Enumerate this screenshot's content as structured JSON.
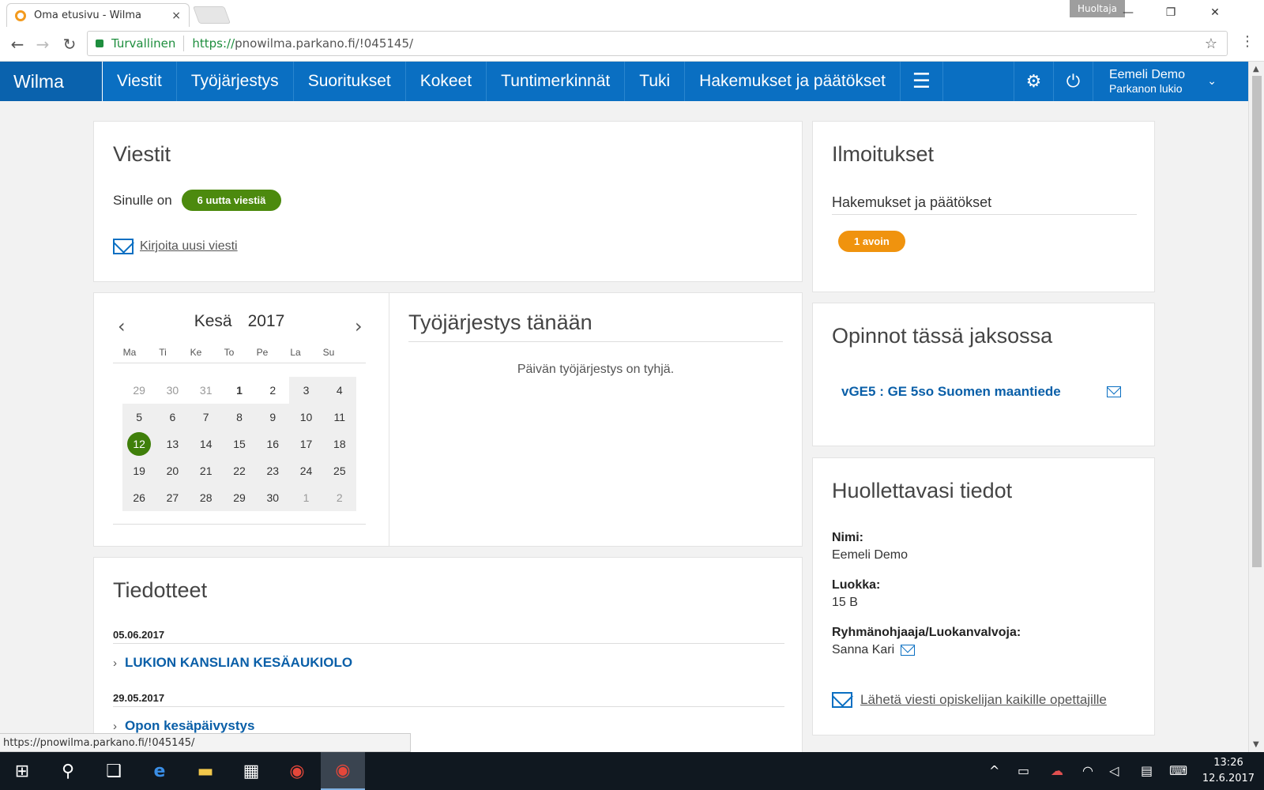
{
  "browser": {
    "tab_title": "Oma etusivu - Wilma",
    "tab_close": "×",
    "profile_chip": "Huoltaja",
    "minimize": "—",
    "restore": "❐",
    "close": "✕",
    "back": "←",
    "forward": "→",
    "reload": "↻",
    "secure_label": "Turvallinen",
    "url_scheme": "https://",
    "url_rest": "pnowilma.parkano.fi/!045145/",
    "star": "☆",
    "menu": "⋮",
    "status_url": "https://pnowilma.parkano.fi/!045145/"
  },
  "nav": {
    "brand": "Wilma",
    "items": [
      "Viestit",
      "Työjärjestys",
      "Suoritukset",
      "Kokeet",
      "Tuntimerkinnät",
      "Tuki",
      "Hakemukset ja päätökset"
    ],
    "hamburger": "☰",
    "settings_icon": "⚙",
    "power_icon": "⏻",
    "user_name": "Eemeli Demo",
    "user_school": "Parkanon lukio",
    "chevron": "⌄"
  },
  "messages": {
    "title": "Viestit",
    "intro": "Sinulle on",
    "badge": "6 uutta viestiä",
    "write_link": "Kirjoita uusi viesti"
  },
  "calendar": {
    "month": "Kesä",
    "year": "2017",
    "prev": "‹",
    "next": "›",
    "weekdays": [
      "Ma",
      "Ti",
      "Ke",
      "To",
      "Pe",
      "La",
      "Su"
    ],
    "weeks": [
      [
        "29",
        "30",
        "31",
        "1",
        "2",
        "3",
        "4"
      ],
      [
        "5",
        "6",
        "7",
        "8",
        "9",
        "10",
        "11"
      ],
      [
        "12",
        "13",
        "14",
        "15",
        "16",
        "17",
        "18"
      ],
      [
        "19",
        "20",
        "21",
        "22",
        "23",
        "24",
        "25"
      ],
      [
        "26",
        "27",
        "28",
        "29",
        "30",
        "1",
        "2"
      ]
    ]
  },
  "schedule": {
    "title": "Työjärjestys tänään",
    "empty": "Päivän työjärjestys on tyhjä."
  },
  "bulletins": {
    "title": "Tiedotteet",
    "items": [
      {
        "date": "05.06.2017",
        "link": "LUKION KANSLIAN KESÄAUKIOLO"
      },
      {
        "date": "29.05.2017",
        "link": "Opon kesäpäivystys"
      }
    ]
  },
  "notices": {
    "title": "Ilmoitukset",
    "section": "Hakemukset ja päätökset",
    "badge": "1 avoin"
  },
  "studies": {
    "title": "Opinnot tässä jaksossa",
    "course": "vGE5 : GE 5so Suomen maantiede"
  },
  "student": {
    "title": "Huollettavasi tiedot",
    "name_label": "Nimi:",
    "name": "Eemeli Demo",
    "class_label": "Luokka:",
    "class": "15 B",
    "teacher_label": "Ryhmänohjaaja/Luokanvalvoja:",
    "teacher": "Sanna Kari",
    "send_all": "Lähetä viesti opiskelijan kaikille opettajille"
  },
  "taskbar": {
    "start": "⊞",
    "search": "⚲",
    "taskview": "❑",
    "edge": "e",
    "explorer": "▬",
    "store": "▦",
    "chrome1": "◉",
    "chrome2": "◉",
    "tray_up": "^",
    "time": "13:26",
    "date": "12.6.2017"
  },
  "colors": {
    "nav_blue": "#0a6fc2",
    "badge_green": "#4c8a0e",
    "badge_orange": "#f0930e",
    "link_blue": "#0a5fa8"
  }
}
